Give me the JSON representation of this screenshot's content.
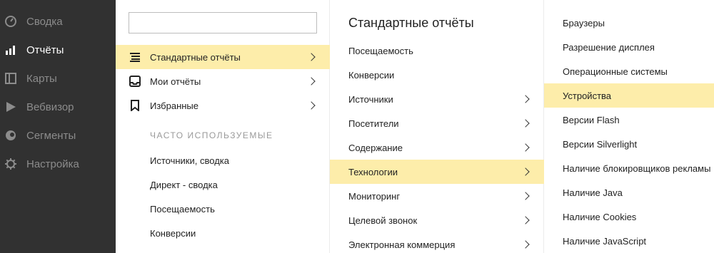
{
  "sidebar": {
    "items": [
      {
        "label": "Сводка",
        "icon": "dashboard-icon"
      },
      {
        "label": "Отчёты",
        "icon": "bar-chart-icon"
      },
      {
        "label": "Карты",
        "icon": "map-icon"
      },
      {
        "label": "Вебвизор",
        "icon": "play-icon"
      },
      {
        "label": "Сегменты",
        "icon": "segments-icon"
      },
      {
        "label": "Настройка",
        "icon": "gear-icon"
      }
    ],
    "active_index": 1
  },
  "reports_menu": {
    "search": {
      "value": "",
      "placeholder": ""
    },
    "categories": [
      {
        "label": "Стандартные отчёты",
        "icon": "list-icon",
        "selected": true
      },
      {
        "label": "Мои отчёты",
        "icon": "inbox-icon",
        "selected": false
      },
      {
        "label": "Избранные",
        "icon": "bookmark-icon",
        "selected": false
      }
    ],
    "frequent_heading": "ЧАСТО ИСПОЛЬЗУЕМЫЕ",
    "frequent": [
      "Источники, сводка",
      "Директ - сводка",
      "Посещаемость",
      "Конверсии"
    ]
  },
  "standard_reports": {
    "title": "Стандартные отчёты",
    "items": [
      {
        "label": "Посещаемость",
        "has_submenu": false
      },
      {
        "label": "Конверсии",
        "has_submenu": false
      },
      {
        "label": "Источники",
        "has_submenu": true
      },
      {
        "label": "Посетители",
        "has_submenu": true
      },
      {
        "label": "Содержание",
        "has_submenu": true
      },
      {
        "label": "Технологии",
        "has_submenu": true,
        "selected": true
      },
      {
        "label": "Мониторинг",
        "has_submenu": true
      },
      {
        "label": "Целевой звонок",
        "has_submenu": true
      },
      {
        "label": "Электронная коммерция",
        "has_submenu": true
      }
    ]
  },
  "technologies": {
    "items": [
      {
        "label": "Браузеры"
      },
      {
        "label": "Разрешение дисплея"
      },
      {
        "label": "Операционные системы"
      },
      {
        "label": "Устройства",
        "selected": true
      },
      {
        "label": "Версии Flash"
      },
      {
        "label": "Версии Silverlight"
      },
      {
        "label": "Наличие блокировщиков рекламы"
      },
      {
        "label": "Наличие Java"
      },
      {
        "label": "Наличие Cookies"
      },
      {
        "label": "Наличие JavaScript"
      }
    ]
  },
  "colors": {
    "sidebar_bg": "#313131",
    "sidebar_text": "#8c8c8c",
    "sidebar_active_text": "#ffffff",
    "highlight": "#fdedaa"
  }
}
